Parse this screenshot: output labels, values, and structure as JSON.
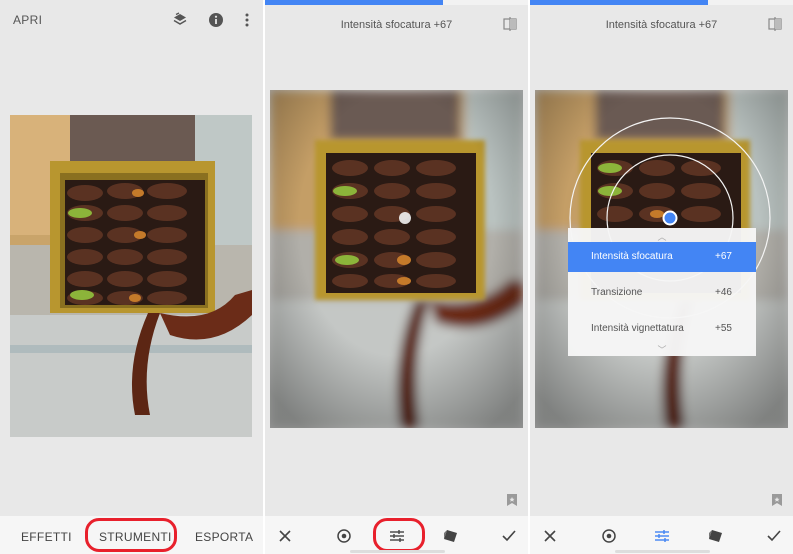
{
  "panel1": {
    "title": "APRI",
    "icons": [
      "layers-icon",
      "info-icon",
      "more-vert-icon"
    ],
    "tabs": [
      {
        "label": "EFFETTI"
      },
      {
        "label": "STRUMENTI",
        "highlighted": true
      },
      {
        "label": "ESPORTA"
      }
    ]
  },
  "panel2": {
    "header": "Intensità sfocatura +67",
    "tools": [
      "close-icon",
      "target-icon",
      "tune-icon",
      "style-icon",
      "check-icon"
    ],
    "highlighted_tool": "tune-icon"
  },
  "panel3": {
    "header": "Intensità sfocatura +67",
    "menu": [
      {
        "label": "Intensità sfocatura",
        "value": "+67",
        "active": true
      },
      {
        "label": "Transizione",
        "value": "+46",
        "active": false
      },
      {
        "label": "Intensità vignettatura",
        "value": "+55",
        "active": false
      }
    ],
    "active_tool": "tune-icon"
  },
  "colors": {
    "accent": "#4385f4",
    "highlight": "#e8202c",
    "panel_bg": "#e8e8e8"
  }
}
